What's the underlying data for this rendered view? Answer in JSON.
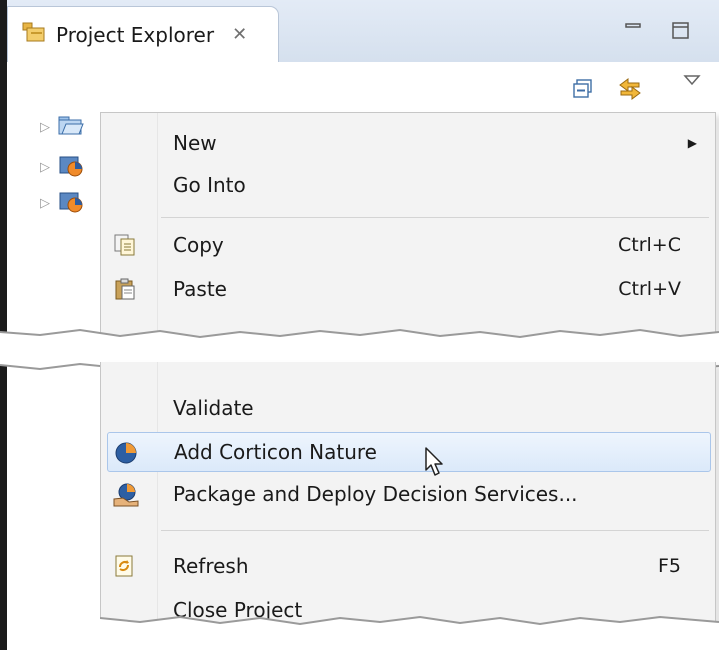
{
  "view": {
    "title": "Project Explorer",
    "close_glyph": "✕",
    "minimize_icon": "minimize-icon",
    "maximize_icon": "maximize-icon",
    "toolbar_icons": [
      "collapse-all-icon",
      "link-with-editor-icon",
      "view-menu-icon"
    ]
  },
  "tree": {
    "items": [
      {
        "icon": "folder-open-icon"
      },
      {
        "icon": "corticon-project-icon"
      },
      {
        "icon": "corticon-project-icon"
      }
    ]
  },
  "context_menu": {
    "group1": [
      {
        "label": "New",
        "submenu": "▶"
      },
      {
        "label": "Go Into"
      }
    ],
    "group2": [
      {
        "label": "Copy",
        "shortcut": "Ctrl+C",
        "icon": "copy-icon"
      },
      {
        "label": "Paste",
        "shortcut": "Ctrl+V",
        "icon": "paste-icon"
      }
    ],
    "group3": [
      {
        "label": "Validate"
      },
      {
        "label": "Add Corticon Nature",
        "icon": "corticon-nature-icon",
        "highlighted": true
      },
      {
        "label": "Package and Deploy Decision Services...",
        "icon": "deploy-icon"
      }
    ],
    "group4": [
      {
        "label": "Refresh",
        "shortcut": "F5",
        "icon": "refresh-icon"
      },
      {
        "label": "Close Project"
      }
    ]
  },
  "colors": {
    "menu_bg": "#f3f3f3",
    "highlight_bg": "#dbe9fa",
    "highlight_border": "#aac6ea",
    "tab_bar_bg": "#d5e0ee"
  }
}
